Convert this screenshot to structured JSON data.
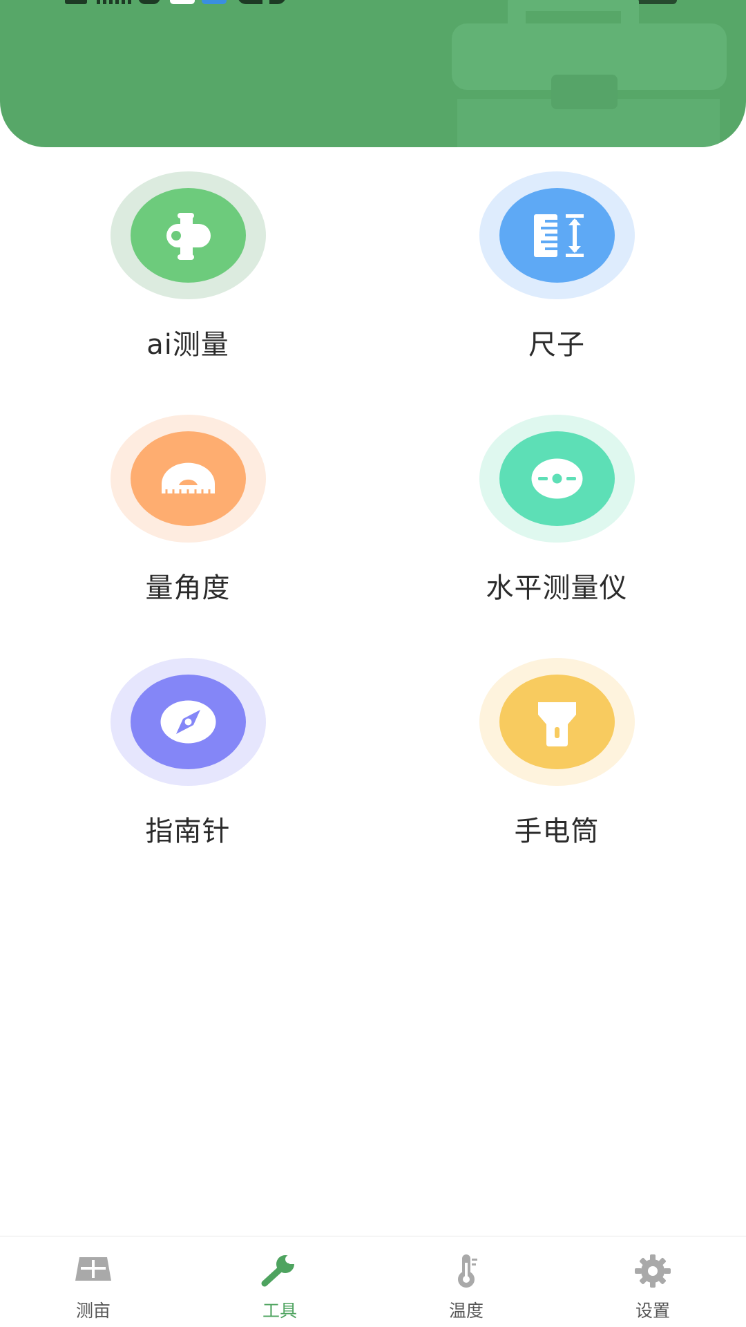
{
  "colors": {
    "header": "#57a768",
    "accent": "#4ea35f",
    "inactive": "#a7a7a7"
  },
  "tools": [
    {
      "label": "ai测量",
      "icon": "ai-measure-icon",
      "color": "#6dcb7c",
      "halo": "#dcebdf"
    },
    {
      "label": "尺子",
      "icon": "ruler-icon",
      "color": "#5ea9f5",
      "halo": "#deecfd"
    },
    {
      "label": "量角度",
      "icon": "protractor-icon",
      "color": "#fead70",
      "halo": "#feece0"
    },
    {
      "label": "水平测量仪",
      "icon": "level-icon",
      "color": "#5ddfb6",
      "halo": "#dff8ef"
    },
    {
      "label": "指南针",
      "icon": "compass-icon",
      "color": "#8486f7",
      "halo": "#e6e6fd"
    },
    {
      "label": "手电筒",
      "icon": "flashlight-icon",
      "color": "#f8cb5f",
      "halo": "#fef3dd"
    }
  ],
  "nav": [
    {
      "label": "测亩",
      "icon": "field-icon",
      "active": false
    },
    {
      "label": "工具",
      "icon": "wrench-icon",
      "active": true
    },
    {
      "label": "温度",
      "icon": "thermometer-icon",
      "active": false
    },
    {
      "label": "设置",
      "icon": "gear-icon",
      "active": false
    }
  ]
}
